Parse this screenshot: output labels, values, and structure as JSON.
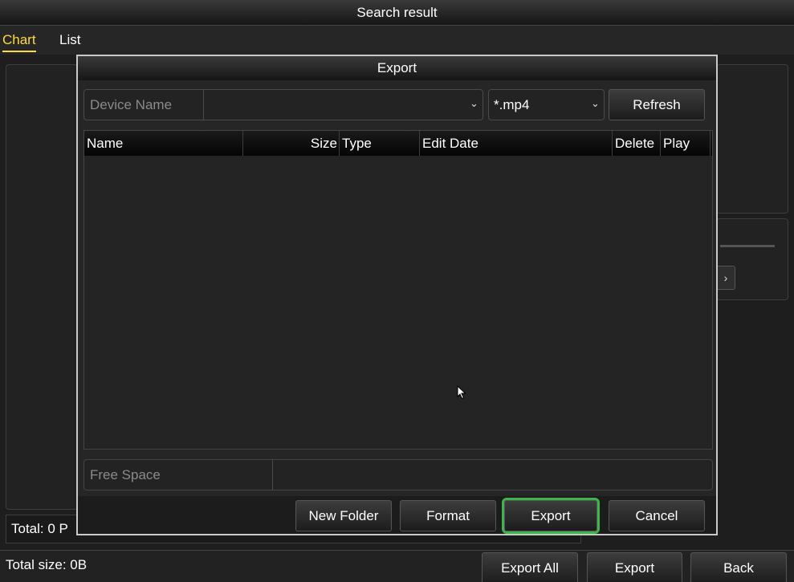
{
  "window": {
    "title": "Search result"
  },
  "tabs": [
    {
      "label": "Chart",
      "active": true
    },
    {
      "label": "List",
      "active": false
    }
  ],
  "background": {
    "total_text": "Total: 0  P",
    "total_size": "Total size: 0B",
    "nav_next_glyph": "›"
  },
  "footer": {
    "export_all": "Export All",
    "export": "Export",
    "back": "Back"
  },
  "dialog": {
    "title": "Export",
    "device_label": "Device Name",
    "device_value": "",
    "file_type": "*.mp4",
    "refresh": "Refresh",
    "columns": [
      "Name",
      "Size",
      "Type",
      "Edit Date",
      "Delete",
      "Play"
    ],
    "rows": [],
    "free_space_label": "Free Space",
    "free_space_value": "",
    "buttons": {
      "new_folder": "New Folder",
      "format": "Format",
      "export": "Export",
      "cancel": "Cancel"
    }
  },
  "colors": {
    "active_tab": "#ffdd33",
    "focus_highlight": "#3cb54a"
  },
  "icons": {
    "dropdown": "chevron-down-icon",
    "cursor": "mouse-pointer-icon"
  }
}
